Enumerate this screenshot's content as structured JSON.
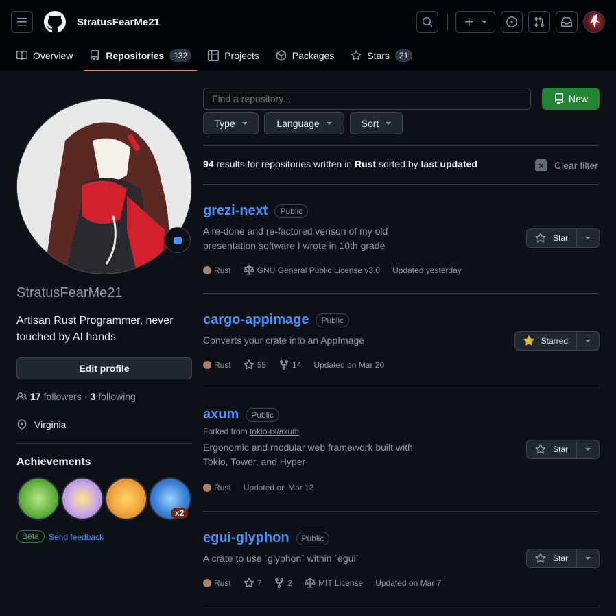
{
  "header": {
    "username": "StratusFearMe21",
    "tabs": [
      {
        "label": "Overview",
        "icon": "book-icon"
      },
      {
        "label": "Repositories",
        "icon": "repo-icon",
        "count": "132"
      },
      {
        "label": "Projects",
        "icon": "table-icon"
      },
      {
        "label": "Packages",
        "icon": "package-icon"
      },
      {
        "label": "Stars",
        "icon": "star-icon",
        "count": "21"
      }
    ]
  },
  "profile": {
    "name": "StratusFearMe21",
    "bio": "Artisan Rust Programmer, never touched by AI hands",
    "edit_label": "Edit profile",
    "followers_count": "17",
    "followers_label": "followers",
    "following_count": "3",
    "following_label": "following",
    "separator": "·",
    "location": "Virginia",
    "achievements_title": "Achievements",
    "achievement_multiplier": "x2",
    "beta_label": "Beta",
    "feedback_label": "Send feedback"
  },
  "repo_list": {
    "search_placeholder": "Find a repository...",
    "new_label": "New",
    "filters": {
      "type": "Type",
      "language": "Language",
      "sort": "Sort"
    },
    "results": {
      "count": "94",
      "text1": "results for repositories written in",
      "language": "Rust",
      "text2": "sorted by",
      "sort": "last updated"
    },
    "clear_filter_label": "Clear filter",
    "repos": [
      {
        "name": "grezi-next",
        "visibility": "Public",
        "description": "A re-done and re-factored verison of my old presentation software I wrote in 10th grade",
        "language": "Rust",
        "license": "GNU General Public License v3.0",
        "updated": "Updated yesterday",
        "star_label": "Star"
      },
      {
        "name": "cargo-appimage",
        "visibility": "Public",
        "description": "Converts your crate into an AppImage",
        "language": "Rust",
        "stars": "55",
        "forks": "14",
        "updated": "Updated on Mar 20",
        "star_label": "Starred"
      },
      {
        "name": "axum",
        "visibility": "Public",
        "forked_prefix": "Forked from",
        "forked_from": "tokio-rs/axum",
        "description": "Ergonomic and modular web framework built with Tokio, Tower, and Hyper",
        "language": "Rust",
        "updated": "Updated on Mar 12",
        "star_label": "Star"
      },
      {
        "name": "egui-glyphon",
        "visibility": "Public",
        "description": "A crate to use `glyphon` within `egui`",
        "language": "Rust",
        "stars": "7",
        "forks": "2",
        "license": "MIT License",
        "updated": "Updated on Mar 7",
        "star_label": "Star"
      }
    ]
  },
  "colors": {
    "accent_link": "#4493f8",
    "new_button": "#238636",
    "tab_underline": "#f78166",
    "rust_dot": "#dea584",
    "starred": "#e3b341"
  }
}
